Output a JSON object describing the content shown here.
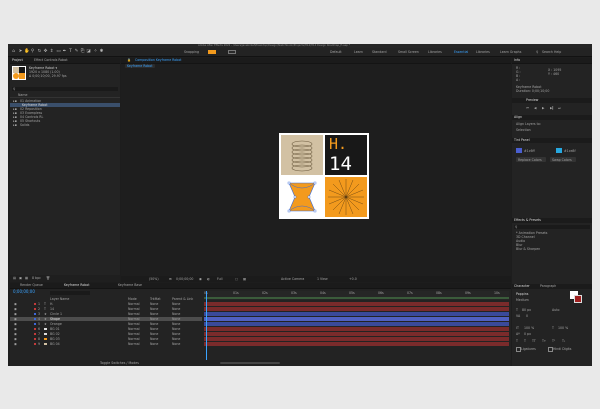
{
  "app": {
    "title": "Adobe After Effects 2022 - /Users/janebirkefl/Desktop/Design/Sketchbook/Projects/H14/H14 Design Roadmap_H.aep *"
  },
  "toolbar": {
    "tools": [
      "home-icon",
      "select-icon",
      "hand-icon",
      "zoom-icon",
      "orbit-icon",
      "pan-icon",
      "dolly-icon",
      "rect-icon",
      "pen-icon",
      "type-icon",
      "brush-icon",
      "clone-icon",
      "eraser-icon",
      "roto-icon",
      "pin-icon"
    ],
    "snapping_label": "Snapping",
    "workspaces": [
      "Default",
      "Learn",
      "Standard",
      "Small Screen",
      "Libraries",
      "Essential",
      "Libraries",
      "Learn Graphs"
    ],
    "active_workspace": "Essential",
    "search_label": "Search Help"
  },
  "project_panel": {
    "tab_label": "Project",
    "tab2_label": "Effect Controls Robot",
    "comp_name": "Keyframe Robot ▾",
    "comp_size": "1920 x 1080 (1.00)",
    "comp_duration": "Δ 0;00;10;00, 29.97 fps",
    "search_placeholder": "",
    "column_header": "Name",
    "items": [
      {
        "label": "01 Animation",
        "selected": false
      },
      {
        "label": "Keyframe Robot",
        "selected": true
      },
      {
        "label": "02 Reposition",
        "selected": false
      },
      {
        "label": "03 Exampless",
        "selected": false
      },
      {
        "label": "04 Controls RL",
        "selected": false
      },
      {
        "label": "05 Shortcuts",
        "selected": false
      },
      {
        "label": "Solids",
        "selected": false
      }
    ],
    "bpc": "8 bpc"
  },
  "comp_viewer": {
    "tab_label": "Composition Keyframe Robot",
    "breadcrumb": "Keyframe Robot",
    "artwork_title": "H.",
    "artwork_number": "14",
    "zoom": "(50%)",
    "timecode": "0;00;00;00",
    "quality": "Full",
    "camera": "Active Camera",
    "views": "1 View",
    "exposure": "+0.0"
  },
  "timeline": {
    "tabs": [
      "Render Queue",
      "Keyframe Robot",
      "Keyframe Base"
    ],
    "current_time": "0;00;00;00",
    "fps_note": "00000 (29.97 fps)",
    "col_source": "Layer Name",
    "col_mode": "Mode",
    "col_trkmat": "TrkMat",
    "col_parent": "Parent & Link",
    "ruler_ticks": [
      "0s",
      "01s",
      "02s",
      "03s",
      "04s",
      "05s",
      "06s",
      "07s",
      "08s",
      "09s",
      "10s"
    ],
    "layers": [
      {
        "num": "1",
        "name": "H.",
        "mode": "Normal",
        "trkmat": "None",
        "parent": "None",
        "color": "#c23b3b"
      },
      {
        "num": "2",
        "name": "14",
        "mode": "Normal",
        "trkmat": "None",
        "parent": "None",
        "color": "#c23b3b"
      },
      {
        "num": "3",
        "name": "Circle 1",
        "mode": "Normal",
        "trkmat": "None",
        "parent": "None",
        "color": "#3f68d8"
      },
      {
        "num": "4",
        "name": "Shape",
        "mode": "Normal",
        "trkmat": "None",
        "parent": "None",
        "color": "#3f68d8"
      },
      {
        "num": "5",
        "name": "Orange",
        "mode": "Normal",
        "trkmat": "None",
        "parent": "None",
        "color": "#3f68d8"
      },
      {
        "num": "6",
        "name": "BG 01",
        "mode": "Normal",
        "trkmat": "None",
        "parent": "None",
        "color": "#c23b3b"
      },
      {
        "num": "7",
        "name": "BG 02",
        "mode": "Normal",
        "trkmat": "None",
        "parent": "None",
        "color": "#c23b3b"
      },
      {
        "num": "8",
        "name": "BG 03",
        "mode": "Normal",
        "trkmat": "None",
        "parent": "None",
        "color": "#c23b3b"
      },
      {
        "num": "9",
        "name": "BG 04",
        "mode": "Normal",
        "trkmat": "None",
        "parent": "None",
        "color": "#c23b3b"
      }
    ],
    "footer_label": "Toggle Switches / Modes"
  },
  "info_panel": {
    "tab_label": "Info",
    "r": "R :",
    "g": "G :",
    "b": "B :",
    "a": "A :",
    "x": "X : 1095",
    "y": "Y : 460",
    "layer_info": "Keyframe Robot",
    "duration": "Duration: 0;00;10;00"
  },
  "preview_panel": {
    "tab_label": "Preview"
  },
  "align_panel": {
    "tab_label": "Align",
    "align_to": "Align Layers to:",
    "align_value": "Selection"
  },
  "color_panel": {
    "tab_label": "Tint Panel",
    "swatch1_label": "#1c6ff",
    "swatch2_label": "#1ce8f",
    "btn1": "Replace Colors",
    "btn2": "Swap Colors"
  },
  "effects_panel": {
    "tab_label": "Effects & Presets",
    "items": [
      "* Animation Presets",
      "3D Channel",
      "Audio",
      "Blur",
      "Blur & Sharpen"
    ]
  },
  "character_panel": {
    "tab_label": "Character",
    "tab2_label": "Paragraph",
    "font": "Poppins",
    "style": "Medium",
    "size": "80 px",
    "leading": "Auto",
    "tracking": "0",
    "scale_v": "100 %",
    "scale_h": "100 %",
    "baseline": "0 px",
    "ligatures": "Ligatures",
    "hindi": "Hindi Digits"
  },
  "colors": {
    "orange": "#f39a1d",
    "tan": "#d2c1a3",
    "accent_blue": "#3aa3ff",
    "track_red": "#7a2b2b",
    "track_blue": "#3a4a9a"
  }
}
